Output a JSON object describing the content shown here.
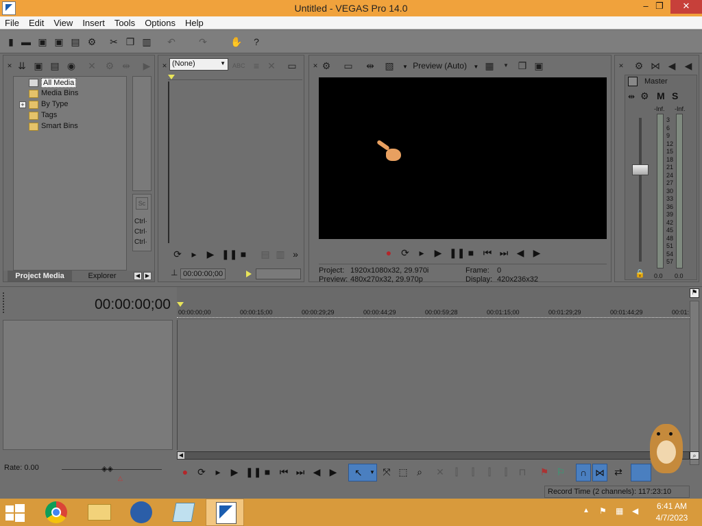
{
  "window": {
    "title": "Untitled - VEGAS Pro 14.0",
    "controls": {
      "minimize": "–",
      "maximize": "❐",
      "close": "✕"
    }
  },
  "menubar": {
    "items": [
      "File",
      "Edit",
      "View",
      "Insert",
      "Tools",
      "Options",
      "Help"
    ]
  },
  "project_media": {
    "tree": [
      {
        "label": "All Media",
        "selected": true
      },
      {
        "label": "Media Bins"
      },
      {
        "label": "By Type",
        "expander": "+"
      },
      {
        "label": "Tags"
      },
      {
        "label": "Smart Bins"
      }
    ],
    "shortcuts": [
      "Ctrl·",
      "Ctrl·",
      "Ctrl·"
    ],
    "tabs": [
      "Project Media",
      "Explorer"
    ]
  },
  "trimmer": {
    "dropdown_value": "(None)",
    "timecode": "00:00:00;00"
  },
  "preview": {
    "quality_label": "Preview (Auto)",
    "project_label": "Project:",
    "project_value": "1920x1080x32, 29.970i",
    "preview_label": "Preview:",
    "preview_value": "480x270x32, 29.970p",
    "frame_label": "Frame:",
    "frame_value": "0",
    "display_label": "Display:",
    "display_value": "420x236x32"
  },
  "master": {
    "title": "Master",
    "controls": [
      "M",
      "S"
    ],
    "peak_left": "-Inf.",
    "peak_right": "-Inf.",
    "scale": [
      "3",
      "6",
      "9",
      "12",
      "15",
      "18",
      "21",
      "24",
      "27",
      "30",
      "33",
      "36",
      "39",
      "42",
      "45",
      "48",
      "51",
      "54",
      "57"
    ],
    "level_left": "0.0",
    "level_right": "0.0"
  },
  "timeline": {
    "timecode": "00:00:00;00",
    "ruler": [
      "00:00:00;00",
      "00:00:15;00",
      "00:00:29;29",
      "00:00:44;29",
      "00:00:59;28",
      "00:01:15;00",
      "00:01:29;29",
      "00:01:44;29",
      "00:01:"
    ],
    "rate": "Rate: 0.00",
    "record_time": "Record Time (2 channels): 117:23:10"
  },
  "taskbar": {
    "time": "6:41 AM",
    "date": "4/7/2023"
  },
  "colors": {
    "title_bar": "#f0a23c",
    "panel_bg": "#6f6f6f",
    "taskbar": "#d89a3c",
    "selection": "#4a7fc0"
  }
}
